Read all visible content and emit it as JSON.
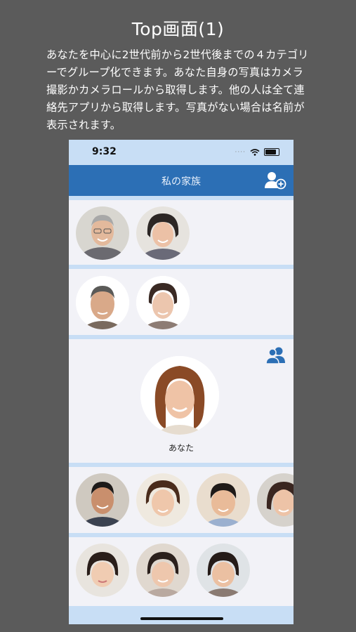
{
  "page": {
    "title": "Top画面(1)",
    "description": "あなたを中心に2世代前から2世代後までの４カテゴリーでグループ化できます。あなた自身の写真はカメラ撮影かカメラロールから取得します。他の人は全て連絡先アプリから取得します。写真がない場合は名前が表示されます。"
  },
  "statusbar": {
    "time": "9:32"
  },
  "navbar": {
    "title": "私の家族",
    "add_icon": "add-person-icon"
  },
  "rows": {
    "grandparents": {
      "count": 2
    },
    "parents": {
      "count": 2
    },
    "self": {
      "label": "あなた",
      "group_icon": "group-icon"
    },
    "children": {
      "count": 4
    },
    "grandchildren": {
      "count": 3
    }
  },
  "colors": {
    "background": "#5b5b5b",
    "navbar": "#2c6fb5",
    "band": "#c8def5",
    "content": "#f2f2f7"
  }
}
